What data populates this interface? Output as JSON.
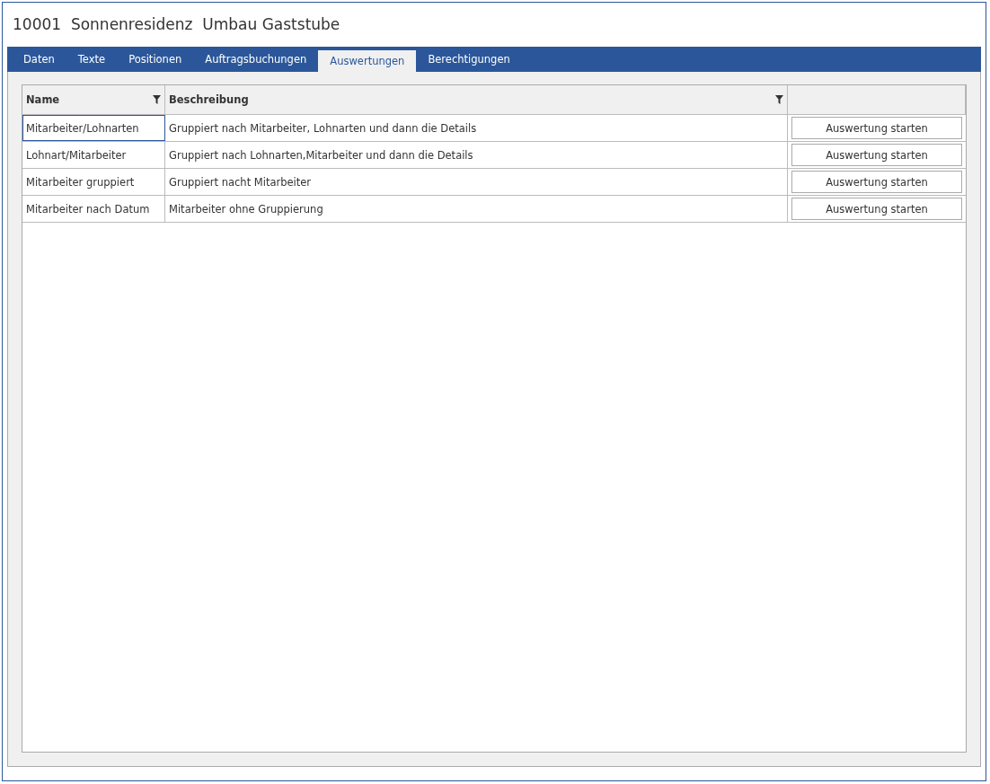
{
  "window": {
    "title": "10001  Sonnenresidenz  Umbau Gaststube"
  },
  "tabs": [
    {
      "label": "Daten",
      "selected": false
    },
    {
      "label": "Texte",
      "selected": false
    },
    {
      "label": "Positionen",
      "selected": false
    },
    {
      "label": "Auftragsbuchungen",
      "selected": false
    },
    {
      "label": "Auswertungen",
      "selected": true
    },
    {
      "label": "Berechtigungen",
      "selected": false
    }
  ],
  "table": {
    "columns": [
      {
        "label": "Name",
        "filter": true
      },
      {
        "label": "Beschreibung",
        "filter": true
      }
    ],
    "rows": [
      {
        "name": "Mitarbeiter/Lohnarten",
        "description": "Gruppiert nach Mitarbeiter, Lohnarten und dann die Details",
        "button": "Auswertung starten",
        "selected": true
      },
      {
        "name": "Lohnart/Mitarbeiter",
        "description": "Gruppiert nach Lohnarten,Mitarbeiter und dann die Details",
        "button": "Auswertung starten",
        "selected": false
      },
      {
        "name": "Mitarbeiter gruppiert",
        "description": "Gruppiert nacht Mitarbeiter",
        "button": "Auswertung starten",
        "selected": false
      },
      {
        "name": "Mitarbeiter nach Datum",
        "description": "Mitarbeiter ohne Gruppierung",
        "button": "Auswertung starten",
        "selected": false
      }
    ]
  }
}
